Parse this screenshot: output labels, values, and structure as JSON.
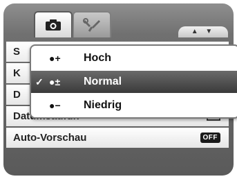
{
  "tabs": [
    {
      "icon": "camera-icon"
    },
    {
      "icon": "wrench-icon"
    }
  ],
  "scroll": {
    "label": "▲ ▼"
  },
  "menu": {
    "rows": [
      {
        "label": "S",
        "value": ""
      },
      {
        "label": "K",
        "value": ""
      },
      {
        "label": "D",
        "value": ""
      },
      {
        "label": "Datumsaufdr.",
        "value": ""
      },
      {
        "label": "Auto-Vorschau",
        "value": "OFF"
      }
    ]
  },
  "popup": {
    "options": [
      {
        "check": "",
        "symbol": "●+",
        "label": "Hoch",
        "selected": false
      },
      {
        "check": "✓",
        "symbol": "●±",
        "label": "Normal",
        "selected": true
      },
      {
        "check": "",
        "symbol": "●−",
        "label": "Niedrig",
        "selected": false
      }
    ]
  },
  "colors": {
    "accent": "#3a3a3a",
    "panel": "#6b6b6b"
  }
}
